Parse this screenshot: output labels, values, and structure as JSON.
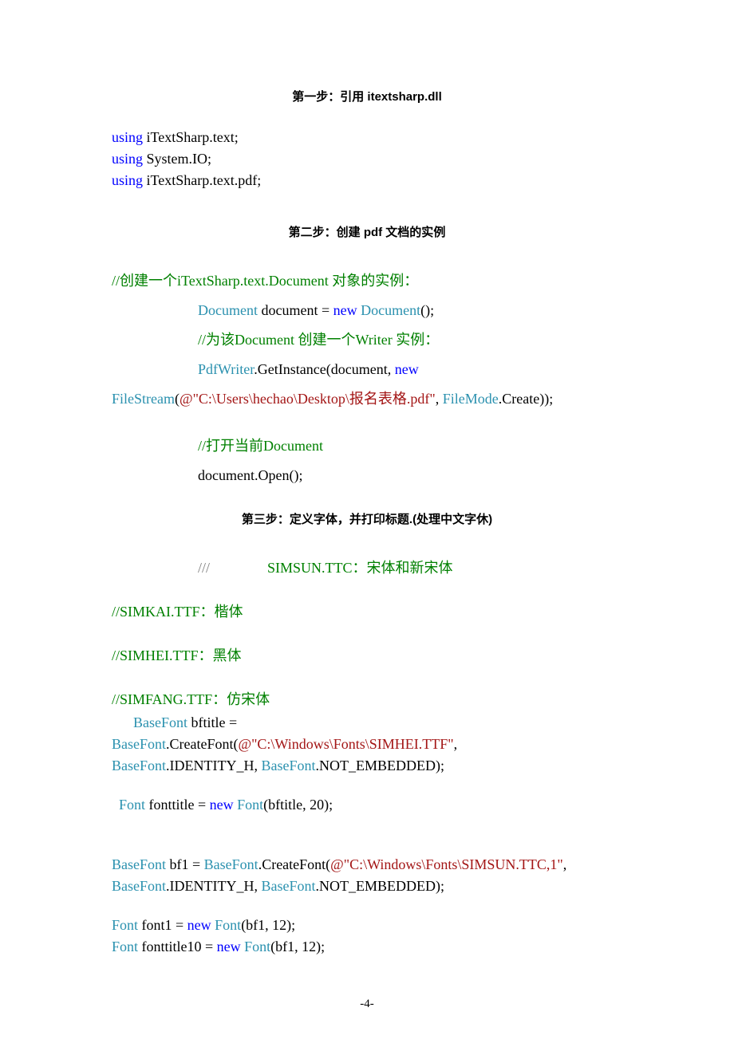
{
  "headings": {
    "h1": "第一步：引用 itextsharp.dll",
    "h2": "第二步：创建 pdf 文档的实例",
    "h3": "第三步：定义字体，并打印标题.(处理中文字休)"
  },
  "section1": {
    "l1": {
      "kw": "using",
      "rest": " iTextSharp.text;"
    },
    "l2": {
      "kw": "using",
      "rest": " System.IO;"
    },
    "l3": {
      "kw": "using",
      "rest": " iTextSharp.text.pdf;"
    }
  },
  "section2": {
    "c1": "//创建一个iTextSharp.text.Document 对象的实例：",
    "l1": {
      "type1": "Document",
      "mid": " document = ",
      "kw": "new",
      "sp": " ",
      "type2": "Document",
      "end": "();"
    },
    "c2": "//为该Document 创建一个Writer 实例：",
    "l2": {
      "type": "PdfWriter",
      "mid": ".GetInstance(document, ",
      "kw": "new"
    },
    "l3": {
      "type1": "FileStream",
      "open": "(",
      "at": "@\"C:\\Users\\hechao\\Desktop\\报名表格.pdf\"",
      "mid": ", ",
      "type2": "FileMode",
      "end": ".Create));"
    },
    "c3": "//打开当前Document",
    "l4": "document.Open();"
  },
  "section3": {
    "xml": "///",
    "c0": "SIMSUN.TTC：宋体和新宋体",
    "c1": "//SIMKAI.TTF：楷体",
    "c2": "//SIMHEI.TTF：黑体",
    "c3": "//SIMFANG.TTF：仿宋体",
    "l1": {
      "pre": "      ",
      "type": "BaseFont",
      "rest": " bftitle ="
    },
    "l2": {
      "type": "BaseFont",
      "mid": ".CreateFont(",
      "at": "@\"C:\\Windows\\Fonts\\SIMHEI.TTF\"",
      "end": ","
    },
    "l3": {
      "type1": "BaseFont",
      "mid1": ".IDENTITY_H, ",
      "type2": "BaseFont",
      "end": ".NOT_EMBEDDED);"
    },
    "l4": {
      "pre": "  ",
      "type1": "Font",
      "mid1": " fonttitle = ",
      "kw": "new",
      "sp": " ",
      "type2": "Font",
      "end": "(bftitle, 20);"
    },
    "l5": {
      "type1": "BaseFont",
      "mid1": " bf1 = ",
      "type2": "BaseFont",
      "mid2": ".CreateFont(",
      "at": "@\"C:\\Windows\\Fonts\\SIMSUN.TTC,1\"",
      "end": ","
    },
    "l6": {
      "type1": "BaseFont",
      "mid1": ".IDENTITY_H, ",
      "type2": "BaseFont",
      "end": ".NOT_EMBEDDED);"
    },
    "l7": {
      "type1": "Font",
      "mid1": " font1 = ",
      "kw": "new",
      "sp": " ",
      "type2": "Font",
      "end": "(bf1, 12);"
    },
    "l8": {
      "type1": "Font",
      "mid1": " fonttitle10 = ",
      "kw": "new",
      "sp": " ",
      "type2": "Font",
      "end": "(bf1, 12);"
    }
  },
  "footer": "-4-"
}
